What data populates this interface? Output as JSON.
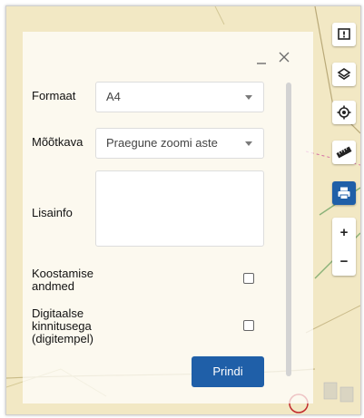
{
  "panel": {
    "minimize_icon": "minimize-icon",
    "close_icon": "close-icon"
  },
  "form": {
    "format_label": "Formaat",
    "format_value": "A4",
    "scale_label": "Mõõtkava",
    "scale_value": "Praegune zoomi aste",
    "info_label": "Lisainfo",
    "info_value": "",
    "compile_data_label_line1": "Koostamise",
    "compile_data_label_line2": "andmed",
    "compile_data_checked": false,
    "digital_stamp_label_line1": "Digitaalse",
    "digital_stamp_label_line2": "kinnitusega",
    "digital_stamp_label_line3": "(digitempel)",
    "digital_stamp_checked": false,
    "print_button": "Prindi"
  },
  "toolbar": {
    "items": [
      {
        "icon": "info-icon",
        "active": false
      },
      {
        "icon": "layers-icon",
        "active": false
      },
      {
        "icon": "locate-icon",
        "active": false
      },
      {
        "icon": "ruler-icon",
        "active": false
      },
      {
        "icon": "print-icon",
        "active": true
      }
    ],
    "zoom_in": "+",
    "zoom_out": "−"
  },
  "colors": {
    "accent": "#1f5fa8",
    "map_bg": "#efe4b8",
    "map_road": "#d4c080",
    "map_boundary_red": "#c0282c"
  }
}
